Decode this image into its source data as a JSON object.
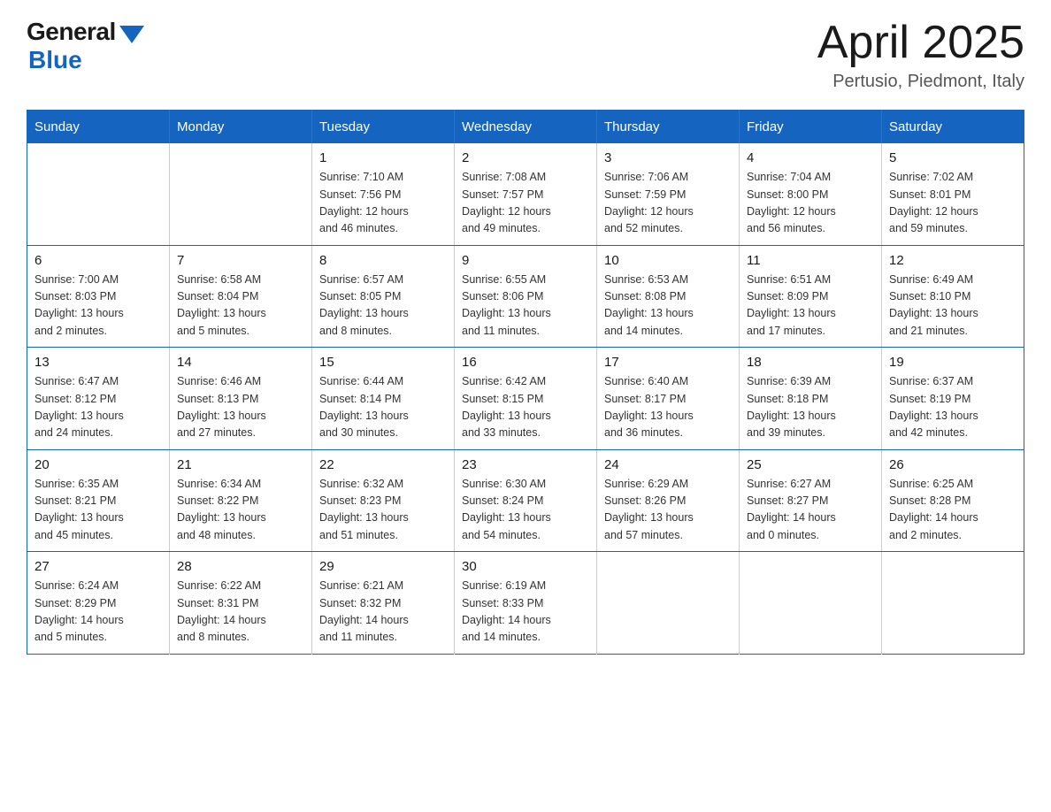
{
  "header": {
    "logo_general": "General",
    "logo_blue": "Blue",
    "month_year": "April 2025",
    "location": "Pertusio, Piedmont, Italy"
  },
  "days_of_week": [
    "Sunday",
    "Monday",
    "Tuesday",
    "Wednesday",
    "Thursday",
    "Friday",
    "Saturday"
  ],
  "weeks": [
    [
      {
        "day": "",
        "info": ""
      },
      {
        "day": "",
        "info": ""
      },
      {
        "day": "1",
        "info": "Sunrise: 7:10 AM\nSunset: 7:56 PM\nDaylight: 12 hours\nand 46 minutes."
      },
      {
        "day": "2",
        "info": "Sunrise: 7:08 AM\nSunset: 7:57 PM\nDaylight: 12 hours\nand 49 minutes."
      },
      {
        "day": "3",
        "info": "Sunrise: 7:06 AM\nSunset: 7:59 PM\nDaylight: 12 hours\nand 52 minutes."
      },
      {
        "day": "4",
        "info": "Sunrise: 7:04 AM\nSunset: 8:00 PM\nDaylight: 12 hours\nand 56 minutes."
      },
      {
        "day": "5",
        "info": "Sunrise: 7:02 AM\nSunset: 8:01 PM\nDaylight: 12 hours\nand 59 minutes."
      }
    ],
    [
      {
        "day": "6",
        "info": "Sunrise: 7:00 AM\nSunset: 8:03 PM\nDaylight: 13 hours\nand 2 minutes."
      },
      {
        "day": "7",
        "info": "Sunrise: 6:58 AM\nSunset: 8:04 PM\nDaylight: 13 hours\nand 5 minutes."
      },
      {
        "day": "8",
        "info": "Sunrise: 6:57 AM\nSunset: 8:05 PM\nDaylight: 13 hours\nand 8 minutes."
      },
      {
        "day": "9",
        "info": "Sunrise: 6:55 AM\nSunset: 8:06 PM\nDaylight: 13 hours\nand 11 minutes."
      },
      {
        "day": "10",
        "info": "Sunrise: 6:53 AM\nSunset: 8:08 PM\nDaylight: 13 hours\nand 14 minutes."
      },
      {
        "day": "11",
        "info": "Sunrise: 6:51 AM\nSunset: 8:09 PM\nDaylight: 13 hours\nand 17 minutes."
      },
      {
        "day": "12",
        "info": "Sunrise: 6:49 AM\nSunset: 8:10 PM\nDaylight: 13 hours\nand 21 minutes."
      }
    ],
    [
      {
        "day": "13",
        "info": "Sunrise: 6:47 AM\nSunset: 8:12 PM\nDaylight: 13 hours\nand 24 minutes."
      },
      {
        "day": "14",
        "info": "Sunrise: 6:46 AM\nSunset: 8:13 PM\nDaylight: 13 hours\nand 27 minutes."
      },
      {
        "day": "15",
        "info": "Sunrise: 6:44 AM\nSunset: 8:14 PM\nDaylight: 13 hours\nand 30 minutes."
      },
      {
        "day": "16",
        "info": "Sunrise: 6:42 AM\nSunset: 8:15 PM\nDaylight: 13 hours\nand 33 minutes."
      },
      {
        "day": "17",
        "info": "Sunrise: 6:40 AM\nSunset: 8:17 PM\nDaylight: 13 hours\nand 36 minutes."
      },
      {
        "day": "18",
        "info": "Sunrise: 6:39 AM\nSunset: 8:18 PM\nDaylight: 13 hours\nand 39 minutes."
      },
      {
        "day": "19",
        "info": "Sunrise: 6:37 AM\nSunset: 8:19 PM\nDaylight: 13 hours\nand 42 minutes."
      }
    ],
    [
      {
        "day": "20",
        "info": "Sunrise: 6:35 AM\nSunset: 8:21 PM\nDaylight: 13 hours\nand 45 minutes."
      },
      {
        "day": "21",
        "info": "Sunrise: 6:34 AM\nSunset: 8:22 PM\nDaylight: 13 hours\nand 48 minutes."
      },
      {
        "day": "22",
        "info": "Sunrise: 6:32 AM\nSunset: 8:23 PM\nDaylight: 13 hours\nand 51 minutes."
      },
      {
        "day": "23",
        "info": "Sunrise: 6:30 AM\nSunset: 8:24 PM\nDaylight: 13 hours\nand 54 minutes."
      },
      {
        "day": "24",
        "info": "Sunrise: 6:29 AM\nSunset: 8:26 PM\nDaylight: 13 hours\nand 57 minutes."
      },
      {
        "day": "25",
        "info": "Sunrise: 6:27 AM\nSunset: 8:27 PM\nDaylight: 14 hours\nand 0 minutes."
      },
      {
        "day": "26",
        "info": "Sunrise: 6:25 AM\nSunset: 8:28 PM\nDaylight: 14 hours\nand 2 minutes."
      }
    ],
    [
      {
        "day": "27",
        "info": "Sunrise: 6:24 AM\nSunset: 8:29 PM\nDaylight: 14 hours\nand 5 minutes."
      },
      {
        "day": "28",
        "info": "Sunrise: 6:22 AM\nSunset: 8:31 PM\nDaylight: 14 hours\nand 8 minutes."
      },
      {
        "day": "29",
        "info": "Sunrise: 6:21 AM\nSunset: 8:32 PM\nDaylight: 14 hours\nand 11 minutes."
      },
      {
        "day": "30",
        "info": "Sunrise: 6:19 AM\nSunset: 8:33 PM\nDaylight: 14 hours\nand 14 minutes."
      },
      {
        "day": "",
        "info": ""
      },
      {
        "day": "",
        "info": ""
      },
      {
        "day": "",
        "info": ""
      }
    ]
  ]
}
